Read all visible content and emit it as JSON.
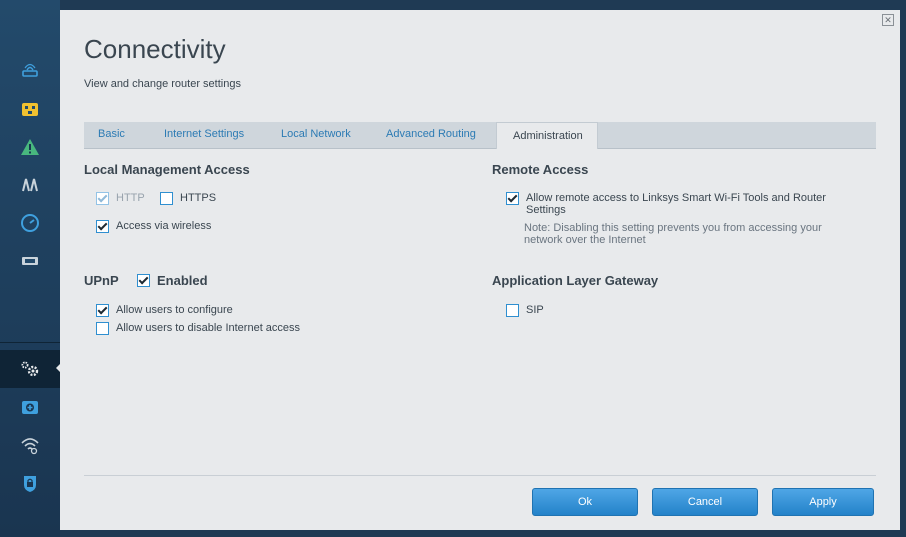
{
  "header": {
    "title": "Connectivity",
    "subtitle": "View and change router settings"
  },
  "tabs": [
    {
      "label": "Basic"
    },
    {
      "label": "Internet Settings"
    },
    {
      "label": "Local Network"
    },
    {
      "label": "Advanced Routing"
    },
    {
      "label": "Administration",
      "active": true
    }
  ],
  "local_management": {
    "heading": "Local Management Access",
    "http_label": "HTTP",
    "https_label": "HTTPS",
    "wireless_label": "Access via wireless",
    "http_checked": true,
    "https_checked": false,
    "wireless_checked": true
  },
  "upnp": {
    "heading": "UPnP",
    "enabled_label": "Enabled",
    "enabled_checked": true,
    "configure_label": "Allow users to configure",
    "configure_checked": true,
    "disable_internet_label": "Allow users to disable Internet access",
    "disable_internet_checked": false
  },
  "remote_access": {
    "heading": "Remote Access",
    "allow_label": "Allow remote access to Linksys Smart Wi-Fi Tools and Router Settings",
    "allow_checked": true,
    "note": "Note: Disabling this setting prevents you from accessing your network over the Internet"
  },
  "alg": {
    "heading": "Application Layer Gateway",
    "sip_label": "SIP",
    "sip_checked": false
  },
  "buttons": {
    "ok": "Ok",
    "cancel": "Cancel",
    "apply": "Apply"
  },
  "sidebar_icons": [
    "router-icon",
    "device-list-icon",
    "alert-icon",
    "parental-controls-icon",
    "speed-test-icon",
    "usb-storage-icon",
    "settings-gear-icon",
    "troubleshooting-icon",
    "wireless-icon",
    "security-lock-icon"
  ],
  "colors": {
    "accent": "#2f8fd0",
    "sidebar": "#1f3a54",
    "panel": "#e8eaec"
  }
}
